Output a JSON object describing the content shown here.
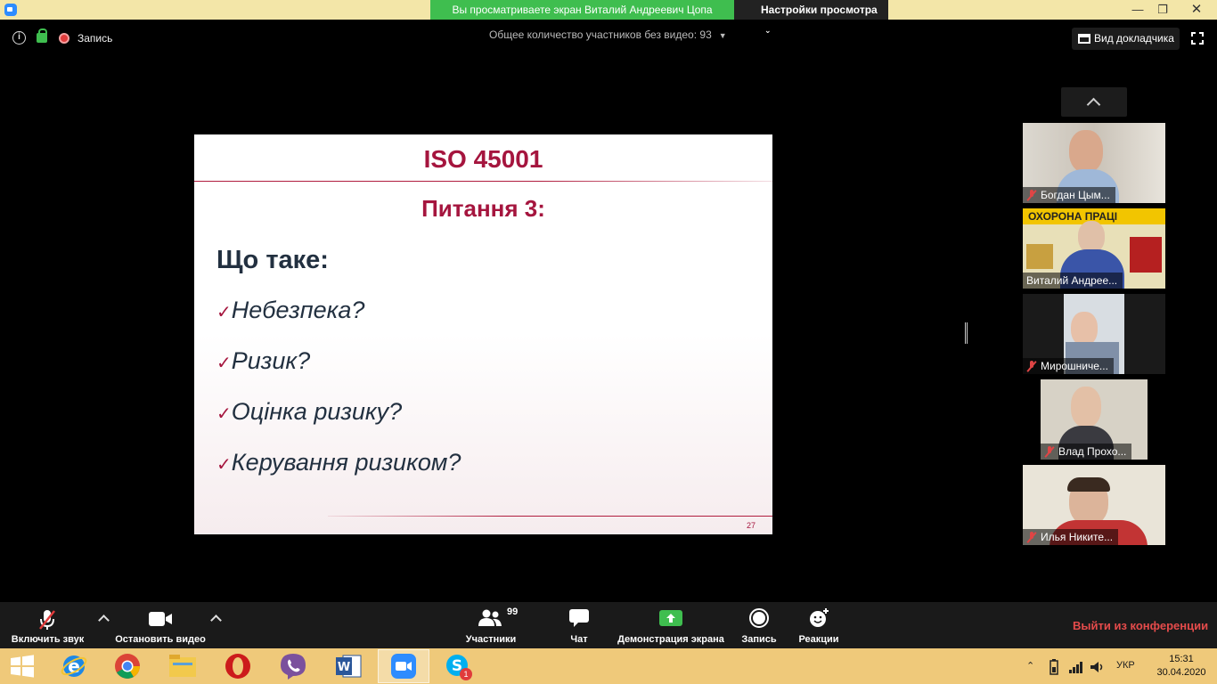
{
  "titlebar": {
    "share_banner": "Вы просматриваете экран Виталий Андреевич Цопа",
    "view_settings": "Настройки просмотра",
    "min": "—",
    "max": "❐",
    "close": "✕"
  },
  "meeting": {
    "recording_label": "Запись",
    "participants_without_video": "Общее количество участников без видео: 93",
    "speaker_view": "Вид докладчика"
  },
  "slide": {
    "title": "ISO 45001",
    "subtitle": "Питання 3:",
    "question": "Що таке:",
    "bullets": [
      "Небезпека?",
      "Ризик?",
      "Оцінка ризику?",
      "Керування ризиком?"
    ],
    "page_number": "27",
    "check_mark": "✓"
  },
  "participants": [
    {
      "name": "Богдан Цым...",
      "muted": true
    },
    {
      "name": "Виталий Андрее...",
      "muted": false
    },
    {
      "name": "Мирошниче...",
      "muted": true
    },
    {
      "name": "Влад Прохо...",
      "muted": true
    },
    {
      "name": "Илья Никите...",
      "muted": true
    }
  ],
  "video_banner_text": "ОХОРОНА ПРАЦІ",
  "toolbar": {
    "audio": "Включить звук",
    "video": "Остановить видео",
    "participants": "Участники",
    "participants_count": "99",
    "chat": "Чат",
    "share": "Демонстрация экрана",
    "record": "Запись",
    "reactions": "Реакции",
    "leave": "Выйти из конференции"
  },
  "taskbar": {
    "language": "УКР",
    "time": "15:31",
    "date": "30.04.2020",
    "skype_badge": "1",
    "colors": {
      "ie": "#1e88e5",
      "chrome": "#db4437",
      "opera": "#cc1b1b",
      "viber": "#7b519d",
      "word": "#2b579a",
      "zoom": "#2d8cff",
      "skype": "#00aff0"
    }
  }
}
